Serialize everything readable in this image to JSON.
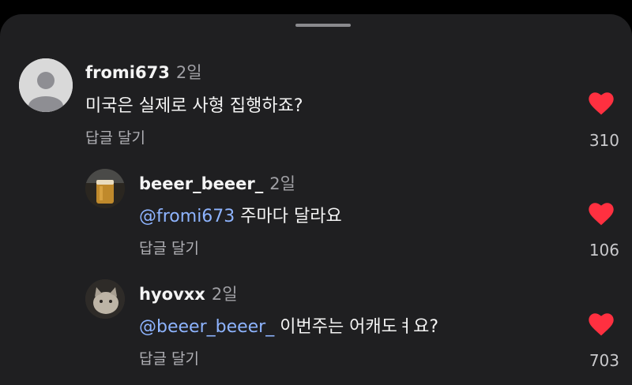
{
  "comments": [
    {
      "username": "fromi673",
      "time": "2일",
      "mention": "",
      "text": "미국은 실제로 사형 집행하죠?",
      "reply_label": "답글 달기",
      "likes": "310",
      "avatar": "default-person-icon"
    },
    {
      "username": "beeer_beeer_",
      "time": "2일",
      "mention": "@fromi673",
      "text": " 주마다 달라요",
      "reply_label": "답글 달기",
      "likes": "106",
      "avatar": "beer-photo"
    },
    {
      "username": "hyovxx",
      "time": "2일",
      "mention": "@beeer_beeer_",
      "text": " 이번주는 어캐도ㅕ요?",
      "reply_label": "답글 달기",
      "likes": "703",
      "avatar": "cat-photo"
    }
  ],
  "colors": {
    "background": "#1f1f21",
    "mention": "#8eb4ff",
    "heart": "#ff3040"
  }
}
